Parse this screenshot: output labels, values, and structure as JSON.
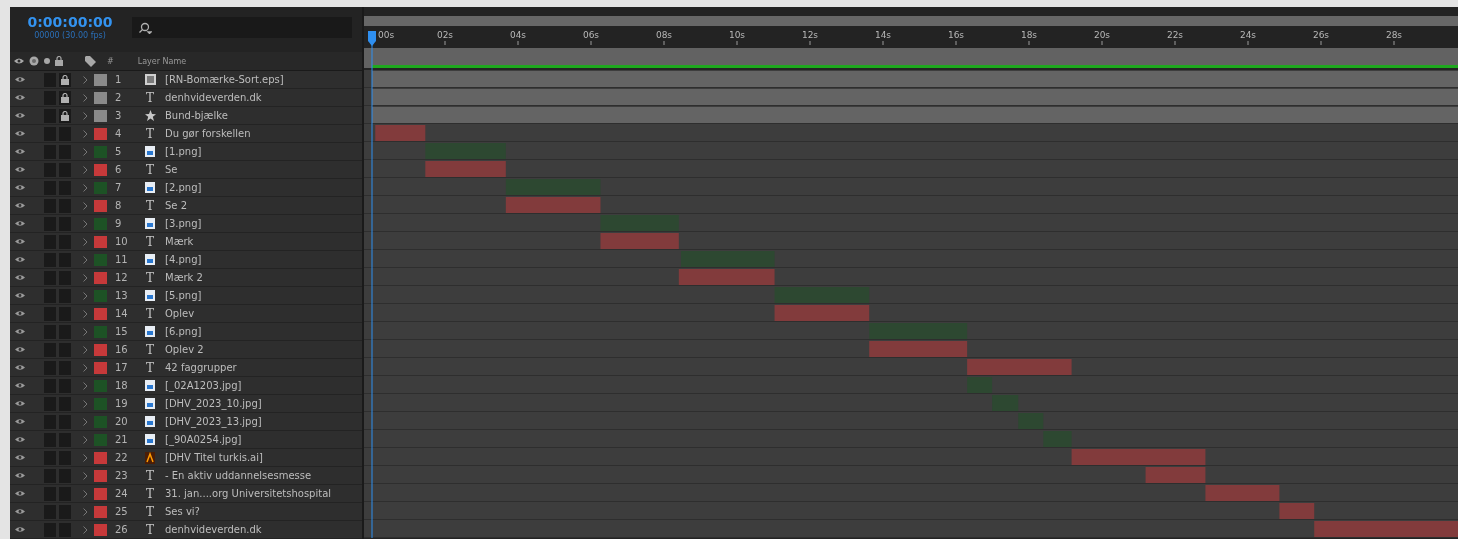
{
  "time": {
    "timecode": "0:00:00:00",
    "frames": "00000 (30.00 fps)"
  },
  "columns": {
    "number": "#",
    "name": "Layer Name"
  },
  "layers": [
    {
      "number": "1",
      "name": "[RN-Bomærke-Sort.eps]",
      "kind": "eps",
      "visible": true,
      "solo": false,
      "locked": true,
      "color": "#8a8a8a"
    },
    {
      "number": "2",
      "name": "denhvideverden.dk",
      "kind": "text",
      "glyph": "T",
      "visible": true,
      "solo": false,
      "locked": true,
      "color": "#8a8a8a"
    },
    {
      "number": "3",
      "name": "Bund-bjælke",
      "kind": "shape",
      "visible": true,
      "solo": false,
      "locked": true,
      "color": "#8a8a8a"
    },
    {
      "number": "4",
      "name": "Du gør forskellen",
      "kind": "text",
      "glyph": "T",
      "visible": true,
      "solo": false,
      "locked": false,
      "color": "#c6393a"
    },
    {
      "number": "5",
      "name": "[1.png]",
      "kind": "image",
      "visible": true,
      "solo": false,
      "locked": false,
      "color": "#1d5225"
    },
    {
      "number": "6",
      "name": "Se",
      "kind": "text",
      "glyph": "T",
      "visible": true,
      "solo": false,
      "locked": false,
      "color": "#c6393a"
    },
    {
      "number": "7",
      "name": "[2.png]",
      "kind": "image",
      "visible": true,
      "solo": false,
      "locked": false,
      "color": "#1d5225"
    },
    {
      "number": "8",
      "name": "Se 2",
      "kind": "text",
      "glyph": "T",
      "visible": true,
      "solo": false,
      "locked": false,
      "color": "#c6393a"
    },
    {
      "number": "9",
      "name": "[3.png]",
      "kind": "image",
      "visible": true,
      "solo": false,
      "locked": false,
      "color": "#1d5225"
    },
    {
      "number": "10",
      "name": "Mærk",
      "kind": "text",
      "glyph": "T",
      "visible": true,
      "solo": false,
      "locked": false,
      "color": "#c6393a"
    },
    {
      "number": "11",
      "name": "[4.png]",
      "kind": "image",
      "visible": true,
      "solo": false,
      "locked": false,
      "color": "#1d5225"
    },
    {
      "number": "12",
      "name": "Mærk 2",
      "kind": "text",
      "glyph": "T",
      "visible": true,
      "solo": false,
      "locked": false,
      "color": "#c6393a"
    },
    {
      "number": "13",
      "name": "[5.png]",
      "kind": "image",
      "visible": true,
      "solo": false,
      "locked": false,
      "color": "#1d5225"
    },
    {
      "number": "14",
      "name": "Oplev",
      "kind": "text",
      "glyph": "T",
      "visible": true,
      "solo": false,
      "locked": false,
      "color": "#c6393a"
    },
    {
      "number": "15",
      "name": "[6.png]",
      "kind": "image",
      "visible": true,
      "solo": false,
      "locked": false,
      "color": "#1d5225"
    },
    {
      "number": "16",
      "name": "Oplev 2",
      "kind": "text",
      "glyph": "T",
      "visible": true,
      "solo": false,
      "locked": false,
      "color": "#c6393a"
    },
    {
      "number": "17",
      "name": "42 faggrupper",
      "kind": "text",
      "glyph": "T",
      "visible": true,
      "solo": false,
      "locked": false,
      "color": "#c6393a"
    },
    {
      "number": "18",
      "name": "[_02A1203.jpg]",
      "kind": "image",
      "visible": true,
      "solo": false,
      "locked": false,
      "color": "#1d5225"
    },
    {
      "number": "19",
      "name": "[DHV_2023_10.jpg]",
      "kind": "image",
      "visible": true,
      "solo": false,
      "locked": false,
      "color": "#1d5225"
    },
    {
      "number": "20",
      "name": "[DHV_2023_13.jpg]",
      "kind": "image",
      "visible": true,
      "solo": false,
      "locked": false,
      "color": "#1d5225"
    },
    {
      "number": "21",
      "name": "[_90A0254.jpg]",
      "kind": "image",
      "visible": true,
      "solo": false,
      "locked": false,
      "color": "#1d5225"
    },
    {
      "number": "22",
      "name": "[DHV Titel turkis.ai]",
      "kind": "illustrator",
      "visible": true,
      "solo": false,
      "locked": false,
      "color": "#c6393a"
    },
    {
      "number": "23",
      "name": "- En aktiv uddannelsesmesse",
      "kind": "text",
      "glyph": "T",
      "visible": true,
      "solo": false,
      "locked": false,
      "color": "#c6393a"
    },
    {
      "number": "24",
      "name": "31. jan....org Universitetshospital",
      "kind": "text",
      "glyph": "T",
      "visible": true,
      "solo": false,
      "locked": false,
      "color": "#c6393a"
    },
    {
      "number": "25",
      "name": "Ses vi?",
      "kind": "text",
      "glyph": "T",
      "visible": true,
      "solo": false,
      "locked": false,
      "color": "#c6393a"
    },
    {
      "number": "26",
      "name": "denhvideverden.dk",
      "kind": "text",
      "glyph": "T",
      "visible": true,
      "solo": false,
      "locked": false,
      "color": "#c6393a"
    }
  ],
  "ruler": {
    "ticks": [
      "00s",
      "02s",
      "04s",
      "06s",
      "08s",
      "10s",
      "12s",
      "14s",
      "16s",
      "18s",
      "20s",
      "22s",
      "24s",
      "26s",
      "28s"
    ]
  }
}
